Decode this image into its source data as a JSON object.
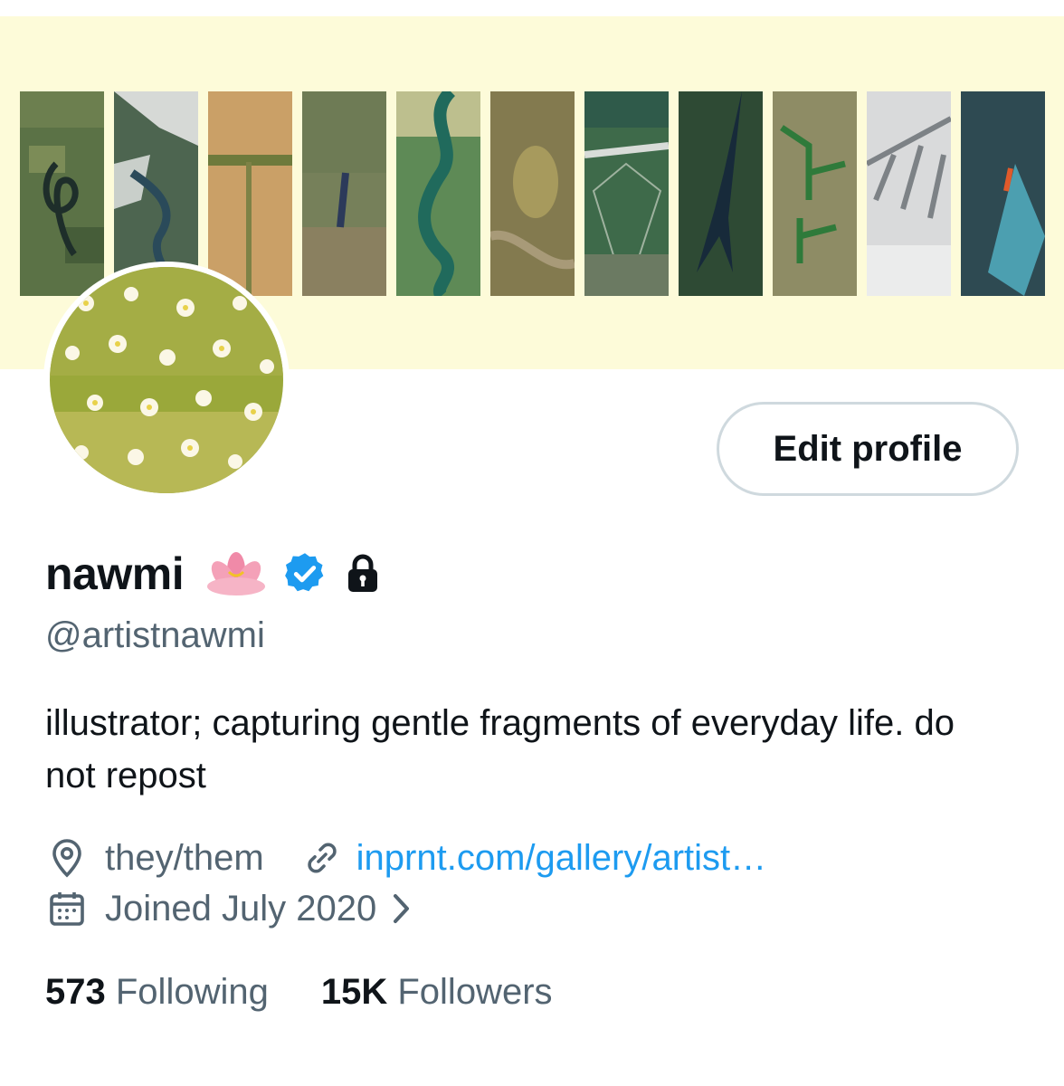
{
  "banner": {
    "tile_colors": [
      "#4f6a3f",
      "#5a6e57",
      "#c49a5a",
      "#6c7a52",
      "#3f7a52",
      "#8a7e52",
      "#3f6a4a",
      "#314a35",
      "#8c8a62",
      "#d9dadb",
      "#2d4e56"
    ]
  },
  "profile": {
    "name": "nawmi",
    "handle": "@artistnawmi",
    "bio": "illustrator; capturing gentle fragments of everyday life. do not repost",
    "pronouns": "they/them",
    "website": "inprnt.com/gallery/artist…",
    "joined": "Joined July 2020",
    "emoji_icon": "lotus-icon",
    "verified_icon": "verified-badge-icon",
    "protected_icon": "lock-icon"
  },
  "actions": {
    "edit_profile_label": "Edit profile"
  },
  "stats": {
    "following_count": "573",
    "following_label": "Following",
    "followers_count": "15K",
    "followers_label": "Followers"
  },
  "colors": {
    "link": "#1d9bf0",
    "secondary_text": "#536471",
    "verified": "#1d9bf0",
    "banner_bg": "#fdfbd9"
  }
}
